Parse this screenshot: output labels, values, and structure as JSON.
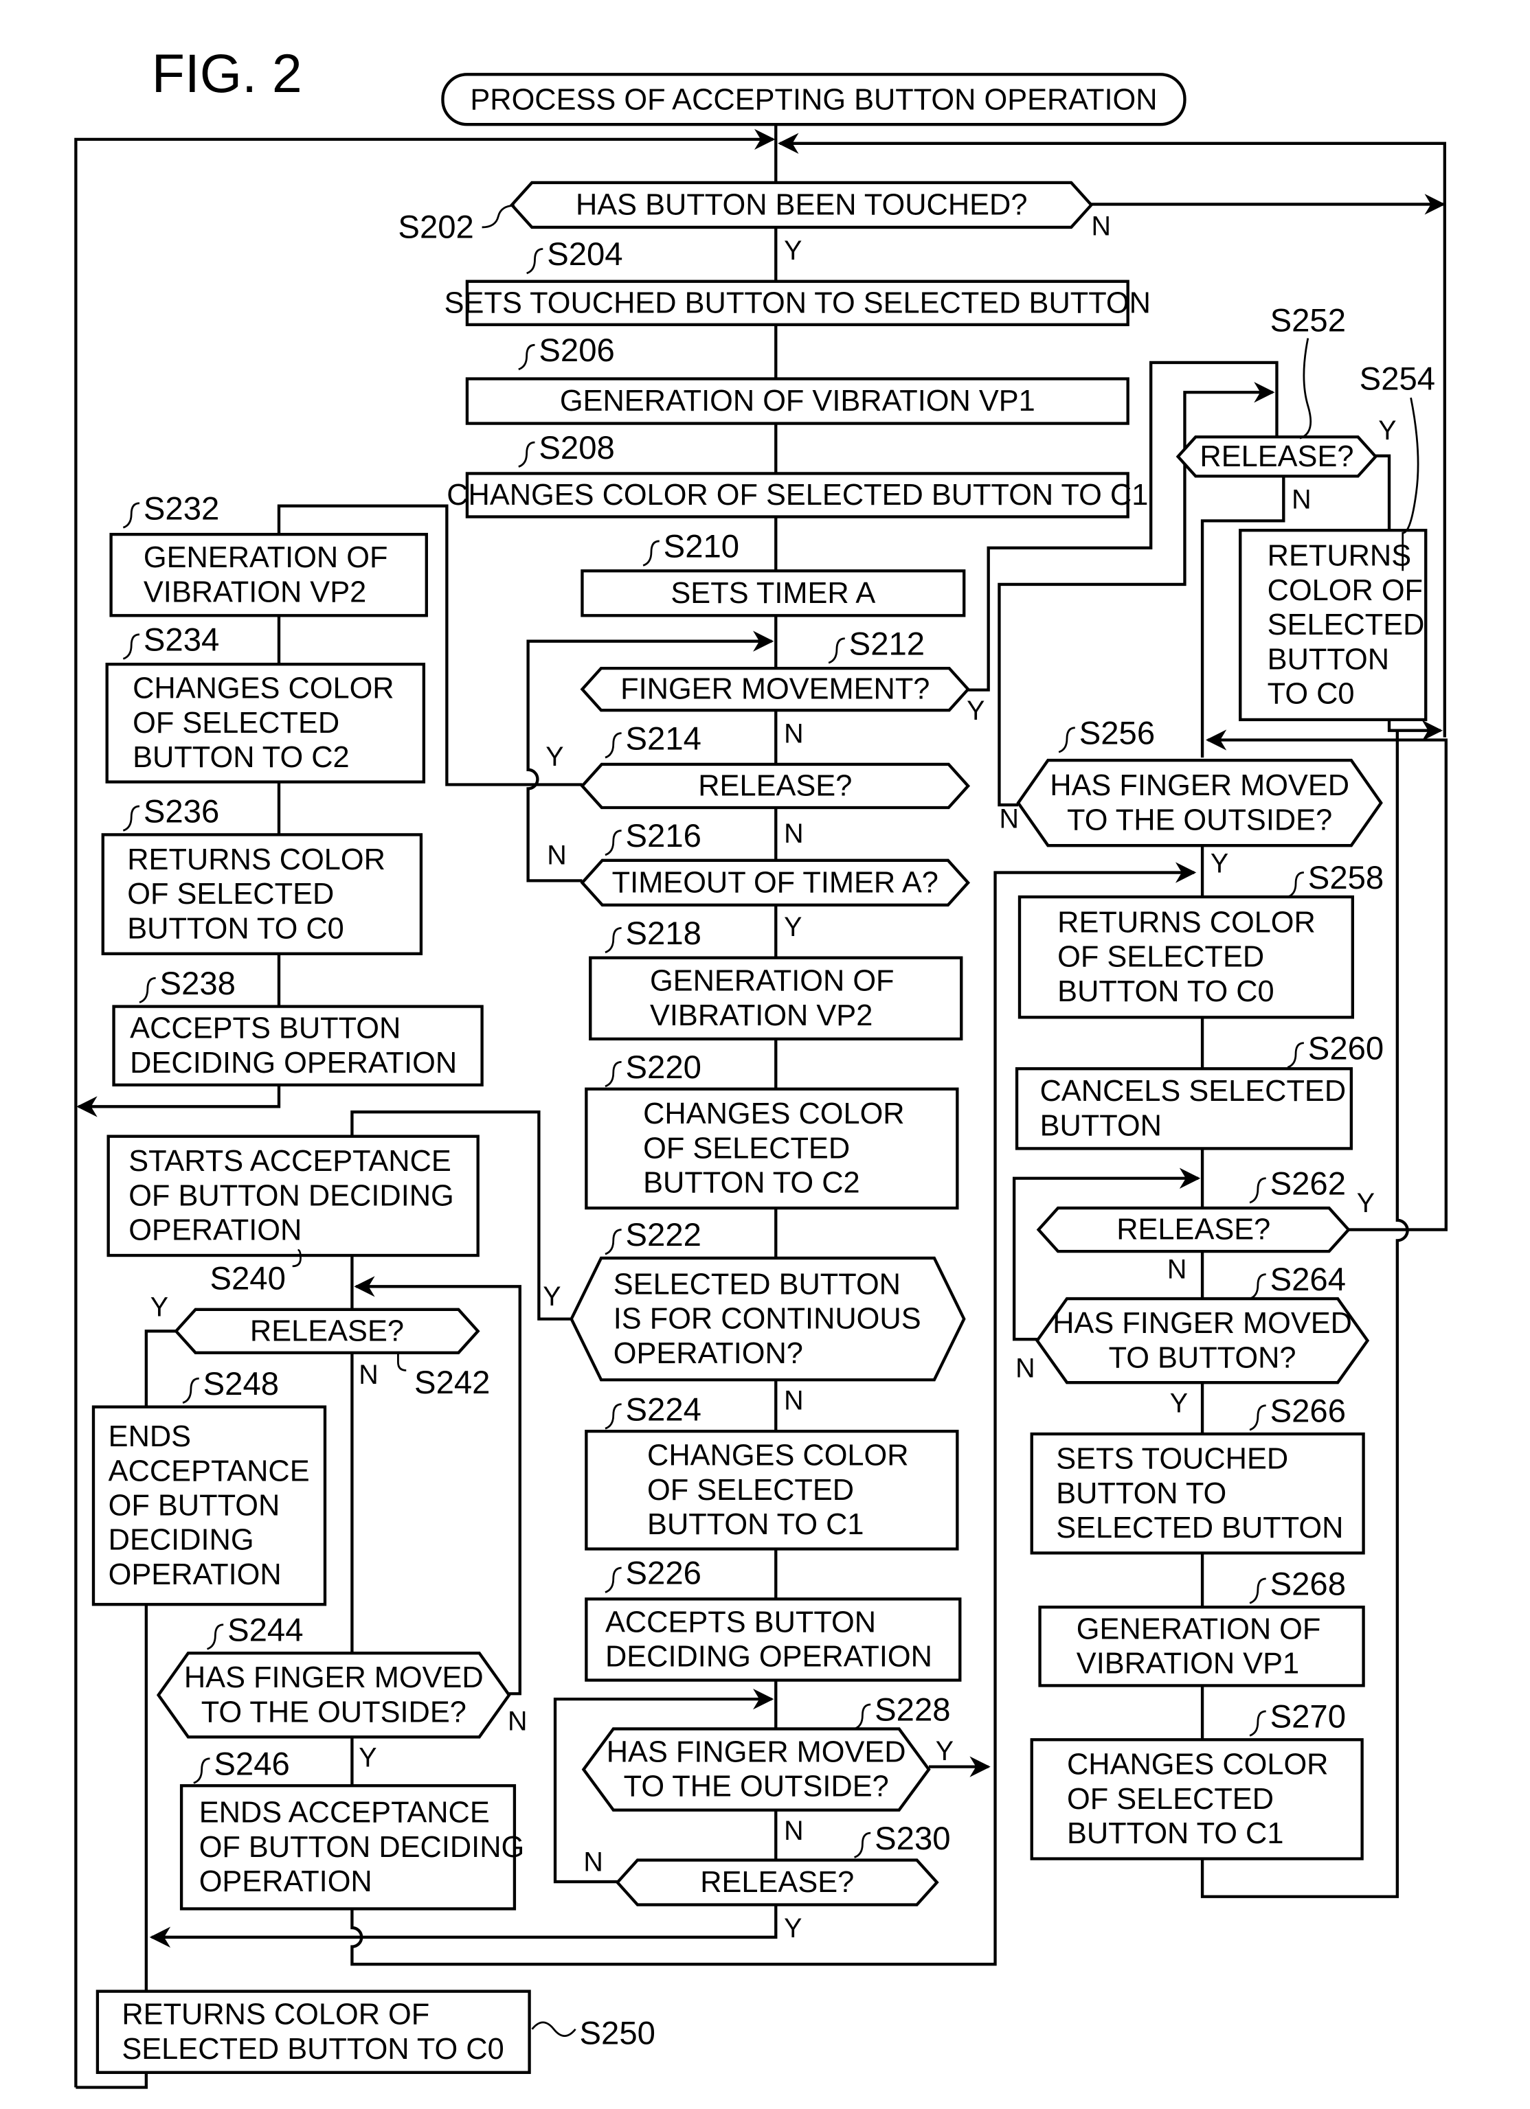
{
  "figure": {
    "title": "FIG. 2"
  },
  "start": {
    "label": "PROCESS OF ACCEPTING BUTTON OPERATION"
  },
  "steps": {
    "S202": {
      "id": "S202",
      "type": "decision",
      "lines": [
        "HAS BUTTON BEEN TOUCHED?"
      ]
    },
    "S204": {
      "id": "S204",
      "type": "process",
      "lines": [
        "SETS TOUCHED BUTTON TO SELECTED BUTTON"
      ]
    },
    "S206": {
      "id": "S206",
      "type": "process",
      "lines": [
        "GENERATION OF VIBRATION VP1"
      ]
    },
    "S208": {
      "id": "S208",
      "type": "process",
      "lines": [
        "CHANGES COLOR OF SELECTED BUTTON TO C1"
      ]
    },
    "S210": {
      "id": "S210",
      "type": "process",
      "lines": [
        "SETS TIMER A"
      ]
    },
    "S212": {
      "id": "S212",
      "type": "decision",
      "lines": [
        "FINGER MOVEMENT?"
      ]
    },
    "S214": {
      "id": "S214",
      "type": "decision",
      "lines": [
        "RELEASE?"
      ]
    },
    "S216": {
      "id": "S216",
      "type": "decision",
      "lines": [
        "TIMEOUT OF TIMER A?"
      ]
    },
    "S218": {
      "id": "S218",
      "type": "process",
      "lines": [
        "GENERATION OF",
        "VIBRATION VP2"
      ]
    },
    "S220": {
      "id": "S220",
      "type": "process",
      "lines": [
        "CHANGES COLOR",
        "OF SELECTED",
        "BUTTON TO C2"
      ]
    },
    "S222": {
      "id": "S222",
      "type": "decision",
      "lines": [
        "SELECTED BUTTON",
        "IS FOR CONTINUOUS",
        "OPERATION?"
      ]
    },
    "S224": {
      "id": "S224",
      "type": "process",
      "lines": [
        "CHANGES COLOR",
        "OF SELECTED",
        "BUTTON TO C1"
      ]
    },
    "S226": {
      "id": "S226",
      "type": "process",
      "lines": [
        "ACCEPTS BUTTON",
        "DECIDING OPERATION"
      ]
    },
    "S228": {
      "id": "S228",
      "type": "decision",
      "lines": [
        "HAS FINGER MOVED",
        "TO THE OUTSIDE?"
      ]
    },
    "S230": {
      "id": "S230",
      "type": "decision",
      "lines": [
        "RELEASE?"
      ]
    },
    "S232": {
      "id": "S232",
      "type": "process",
      "lines": [
        "GENERATION OF",
        "VIBRATION VP2"
      ]
    },
    "S234": {
      "id": "S234",
      "type": "process",
      "lines": [
        "CHANGES COLOR",
        "OF SELECTED",
        "BUTTON TO C2"
      ]
    },
    "S236": {
      "id": "S236",
      "type": "process",
      "lines": [
        "RETURNS COLOR",
        "OF SELECTED",
        "BUTTON TO C0"
      ]
    },
    "S238": {
      "id": "S238",
      "type": "process",
      "lines": [
        "ACCEPTS BUTTON",
        "DECIDING OPERATION"
      ]
    },
    "S240": {
      "id": "S240",
      "type": "process",
      "lines": [
        "STARTS ACCEPTANCE",
        "OF BUTTON DECIDING",
        "OPERATION"
      ]
    },
    "S242": {
      "id": "S242",
      "type": "decision",
      "lines": [
        "RELEASE?"
      ]
    },
    "S244": {
      "id": "S244",
      "type": "decision",
      "lines": [
        "HAS FINGER MOVED",
        "TO THE OUTSIDE?"
      ]
    },
    "S246": {
      "id": "S246",
      "type": "process",
      "lines": [
        "ENDS ACCEPTANCE",
        "OF BUTTON DECIDING",
        "OPERATION"
      ]
    },
    "S248": {
      "id": "S248",
      "type": "process",
      "lines": [
        "ENDS",
        "ACCEPTANCE",
        "OF BUTTON",
        "DECIDING",
        "OPERATION"
      ]
    },
    "S250": {
      "id": "S250",
      "type": "process",
      "lines": [
        "RETURNS COLOR OF",
        "SELECTED BUTTON TO C0"
      ]
    },
    "S252": {
      "id": "S252",
      "type": "decision",
      "lines": [
        "RELEASE?"
      ]
    },
    "S254": {
      "id": "S254",
      "type": "process",
      "lines": [
        "RETURNS",
        "COLOR OF",
        "SELECTED",
        "BUTTON",
        "TO C0"
      ]
    },
    "S256": {
      "id": "S256",
      "type": "decision",
      "lines": [
        "HAS FINGER MOVED",
        "TO THE OUTSIDE?"
      ]
    },
    "S258": {
      "id": "S258",
      "type": "process",
      "lines": [
        "RETURNS COLOR",
        "OF SELECTED",
        "BUTTON TO C0"
      ]
    },
    "S260": {
      "id": "S260",
      "type": "process",
      "lines": [
        "CANCELS SELECTED",
        "BUTTON"
      ]
    },
    "S262": {
      "id": "S262",
      "type": "decision",
      "lines": [
        "RELEASE?"
      ]
    },
    "S264": {
      "id": "S264",
      "type": "decision",
      "lines": [
        "HAS FINGER MOVED",
        "TO BUTTON?"
      ]
    },
    "S266": {
      "id": "S266",
      "type": "process",
      "lines": [
        "SETS TOUCHED",
        "BUTTON TO",
        "SELECTED BUTTON"
      ]
    },
    "S268": {
      "id": "S268",
      "type": "process",
      "lines": [
        "GENERATION OF",
        "VIBRATION VP1"
      ]
    },
    "S270": {
      "id": "S270",
      "type": "process",
      "lines": [
        "CHANGES COLOR",
        "OF SELECTED",
        "BUTTON TO C1"
      ]
    }
  },
  "branch_labels": {
    "yes": "Y",
    "no": "N"
  }
}
